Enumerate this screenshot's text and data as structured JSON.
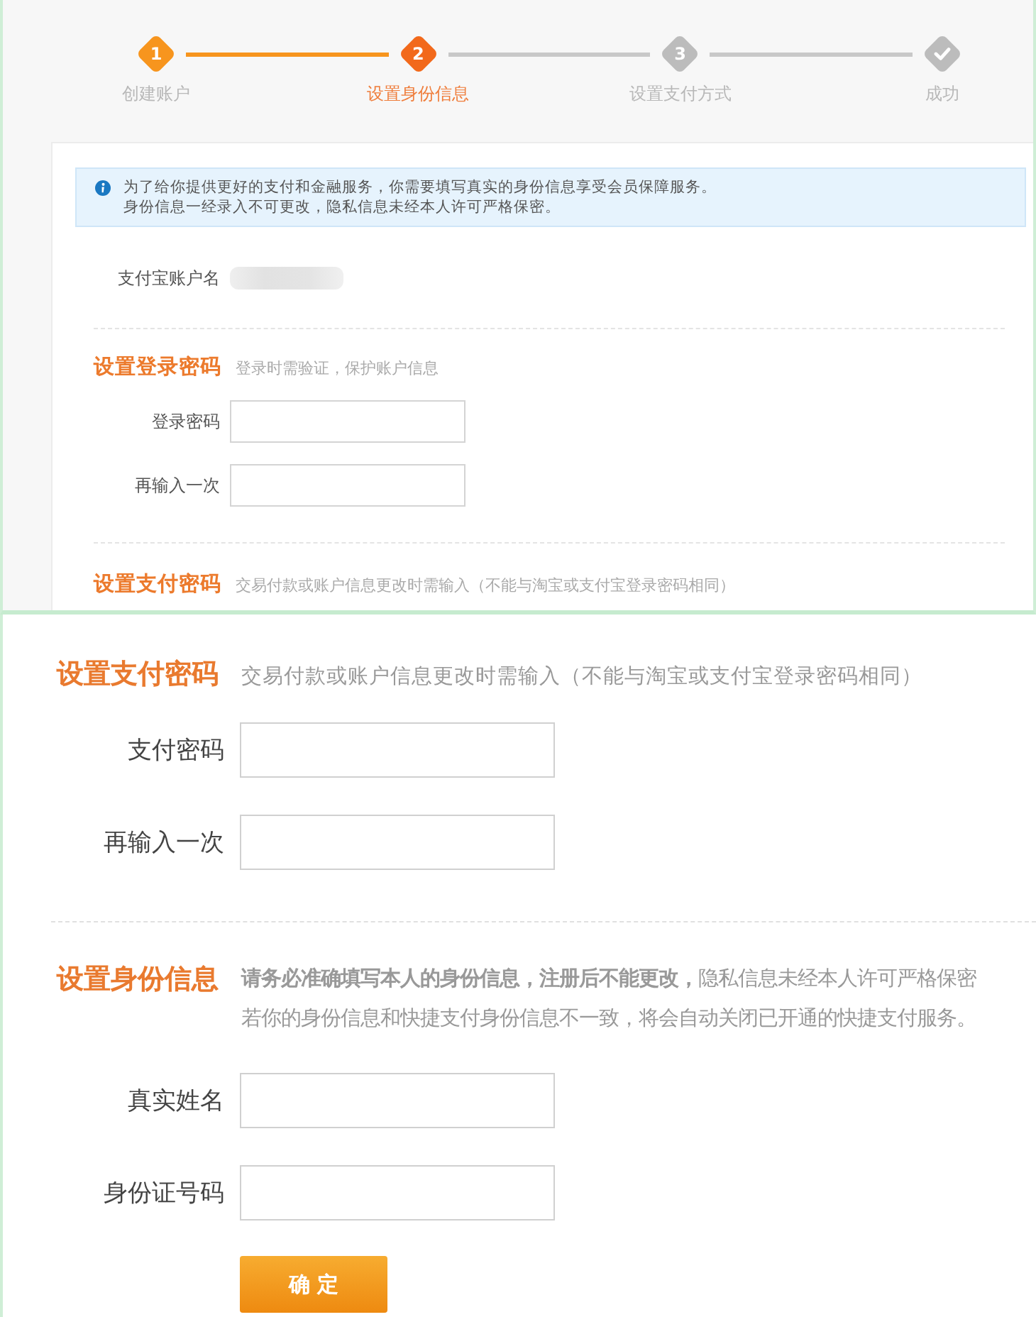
{
  "stepper": {
    "steps": [
      {
        "kind": "number",
        "number": "1",
        "label": "创建账户",
        "completed": true,
        "selected": false
      },
      {
        "kind": "number",
        "number": "2",
        "label": "设置身份信息",
        "completed": false,
        "selected": true
      },
      {
        "kind": "number",
        "number": "3",
        "label": "设置支付方式",
        "completed": false,
        "selected": false
      },
      {
        "kind": "check",
        "label": "成功",
        "completed": false,
        "selected": false
      }
    ]
  },
  "overview_panel": {
    "notice_lines": [
      "为了给你提供更好的支付和金融服务，你需要填写真实的身份信息享受会员保障服务。",
      "身份信息一经录入不可更改，隐私信息未经本人许可严格保密。"
    ],
    "account_name": {
      "label": "支付宝账户名"
    },
    "login_password": {
      "title": "设置登录密码",
      "hint": "登录时需验证，保护账户信息",
      "fields": [
        {
          "label": "登录密码"
        },
        {
          "label": "再输入一次"
        }
      ]
    },
    "pay_password": {
      "title": "设置支付密码",
      "hint": "交易付款或账户信息更改时需输入（不能与淘宝或支付宝登录密码相同）"
    }
  },
  "zoomed_panel": {
    "pay_password": {
      "title": "设置支付密码",
      "hint": "交易付款或账户信息更改时需输入（不能与淘宝或支付宝登录密码相同）",
      "fields": [
        {
          "label": "支付密码"
        },
        {
          "label": "再输入一次"
        }
      ]
    },
    "identity": {
      "title": "设置身份信息",
      "hint_lines": [
        "**请务必准确填写本人的身份信息，注册后不能更改，**隐私信息未经本人许可严格保密",
        "若你的身份信息和快捷支付身份信息不一致，将会自动关闭已开通的快捷支付服务。"
      ],
      "fields": [
        {
          "label": "真实姓名"
        },
        {
          "label": "身份证号码"
        }
      ]
    },
    "submit": "确 定"
  }
}
